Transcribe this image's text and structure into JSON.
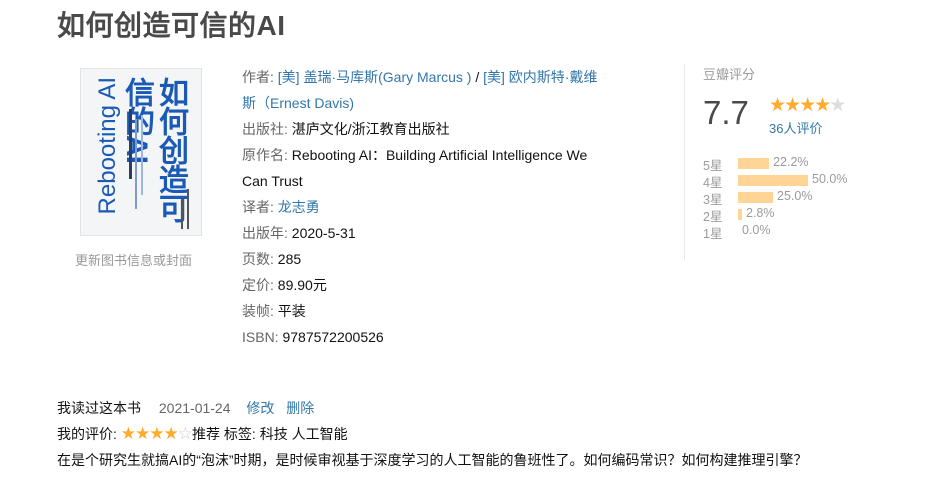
{
  "title": "如何创造可信的AI",
  "cover": {
    "zh_title": "如何创造可信的AI",
    "en_title": "Rebooting AI",
    "update_link": "更新图书信息或封面"
  },
  "info": {
    "author_label": "作者:",
    "author1": "[美] 盖瑞·马库斯(Gary Marcus )",
    "author_sep": " / ",
    "author2_line1": "[美] 欧内斯特·戴维",
    "author2_line2": "斯（Ernest Davis)",
    "publisher_label": "出版社:",
    "publisher": "湛庐文化/浙江教育出版社",
    "original_label": "原作名:",
    "original_line1": "Rebooting AI：Building Artificial Intelligence We",
    "original_line2": "Can Trust",
    "translator_label": "译者:",
    "translator": "龙志勇",
    "pubdate_label": "出版年:",
    "pubdate": "2020-5-31",
    "pages_label": "页数:",
    "pages": "285",
    "price_label": "定价:",
    "price": "89.90元",
    "binding_label": "装帧:",
    "binding": "平装",
    "isbn_label": "ISBN:",
    "isbn": "9787572200526"
  },
  "rating": {
    "title": "豆瓣评分",
    "score": "7.7",
    "stars_filled": 4,
    "stars_total": 5,
    "count": "36人评价",
    "distribution": [
      {
        "label": "5星",
        "pct": "22.2%",
        "value": 22.2
      },
      {
        "label": "4星",
        "pct": "50.0%",
        "value": 50.0
      },
      {
        "label": "3星",
        "pct": "25.0%",
        "value": 25.0
      },
      {
        "label": "2星",
        "pct": "2.8%",
        "value": 2.8
      },
      {
        "label": "1星",
        "pct": "0.0%",
        "value": 0.0
      }
    ]
  },
  "record": {
    "status": "我读过这本书",
    "date": "2021-01-24",
    "edit": "修改",
    "delete": "删除",
    "my_rating_label": "我的评价:",
    "my_stars_filled": 4,
    "recommend": "推荐",
    "tags_label": "标签:",
    "tags": "科技 人工智能",
    "comment": "在是个研究生就搞AI的“泡沫”时期，是时候审视基于深度学习的人工智能的鲁班性了。如何编码常识？如何构建推理引擎？"
  },
  "colors": {
    "link": "#3377aa",
    "star": "#ffac2d",
    "bar": "#ffd596"
  }
}
